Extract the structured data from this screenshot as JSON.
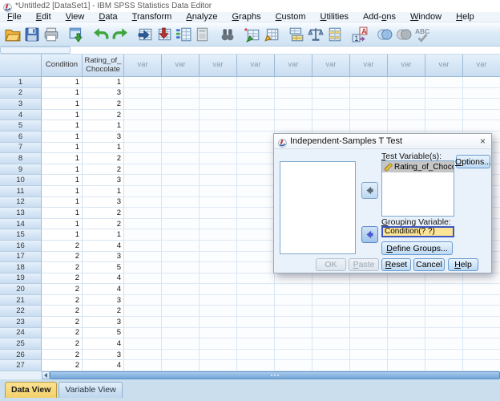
{
  "window": {
    "title": "*Untitled2 [DataSet1] - IBM SPSS Statistics Data Editor"
  },
  "menu": {
    "items": [
      {
        "label": "File",
        "accel": 0
      },
      {
        "label": "Edit",
        "accel": 0
      },
      {
        "label": "View",
        "accel": 0
      },
      {
        "label": "Data",
        "accel": 0
      },
      {
        "label": "Transform",
        "accel": 0
      },
      {
        "label": "Analyze",
        "accel": 0
      },
      {
        "label": "Graphs",
        "accel": 0
      },
      {
        "label": "Custom",
        "accel": 0
      },
      {
        "label": "Utilities",
        "accel": 0
      },
      {
        "label": "Add-ons",
        "accel": 4
      },
      {
        "label": "Window",
        "accel": 0
      },
      {
        "label": "Help",
        "accel": 0
      }
    ]
  },
  "toolbar": {
    "icons": [
      {
        "name": "open-data-icon"
      },
      {
        "name": "save-icon"
      },
      {
        "name": "print-icon"
      },
      {
        "name": "recall-dialogs-icon"
      },
      {
        "name": "undo-icon"
      },
      {
        "name": "redo-icon"
      },
      {
        "name": "goto-case-icon"
      },
      {
        "name": "goto-variable-icon"
      },
      {
        "name": "variables-icon"
      },
      {
        "name": "descriptives-icon"
      },
      {
        "name": "find-icon"
      },
      {
        "name": "insert-cases-icon"
      },
      {
        "name": "insert-variable-icon"
      },
      {
        "name": "split-file-icon"
      },
      {
        "name": "weight-cases-icon"
      },
      {
        "name": "select-cases-icon"
      },
      {
        "name": "value-labels-icon"
      },
      {
        "name": "use-variable-sets-icon"
      },
      {
        "name": "show-all-variables-icon"
      },
      {
        "name": "spell-check-icon"
      }
    ]
  },
  "cell_editor": {
    "reference": "",
    "value": ""
  },
  "grid": {
    "columns": [
      "",
      "Condition",
      "Rating_of_Chocolate"
    ],
    "var_label": "var",
    "var_count": 10,
    "rows": [
      [
        1,
        1
      ],
      [
        1,
        3
      ],
      [
        1,
        2
      ],
      [
        1,
        2
      ],
      [
        1,
        1
      ],
      [
        1,
        3
      ],
      [
        1,
        1
      ],
      [
        1,
        2
      ],
      [
        1,
        2
      ],
      [
        1,
        3
      ],
      [
        1,
        1
      ],
      [
        1,
        3
      ],
      [
        1,
        2
      ],
      [
        1,
        2
      ],
      [
        1,
        1
      ],
      [
        2,
        4
      ],
      [
        2,
        3
      ],
      [
        2,
        5
      ],
      [
        2,
        4
      ],
      [
        2,
        4
      ],
      [
        2,
        3
      ],
      [
        2,
        2
      ],
      [
        2,
        3
      ],
      [
        2,
        5
      ],
      [
        2,
        4
      ],
      [
        2,
        3
      ],
      [
        2,
        4
      ]
    ]
  },
  "tabs": {
    "data_view": "Data View",
    "variable_view": "Variable View",
    "active": "Data View"
  },
  "dialog": {
    "title": "Independent-Samples T Test",
    "close_glyph": "×",
    "test_variables_label": "Test Variable(s):",
    "test_variables": [
      "Rating_of_Chocolate"
    ],
    "grouping_label": "Grouping Variable:",
    "grouping_value": "Condition(? ?)",
    "buttons": {
      "options": "Options...",
      "define_groups": "Define Groups...",
      "ok": "OK",
      "paste": "Paste",
      "reset": "Reset",
      "cancel": "Cancel",
      "help": "Help"
    }
  },
  "colors": {
    "active_tab_bg": "#f3cf6a",
    "active_tab_top": "#fbe391",
    "grouping_field_bg": "#fce597",
    "selected_item_bg": "#c6c6c6"
  }
}
